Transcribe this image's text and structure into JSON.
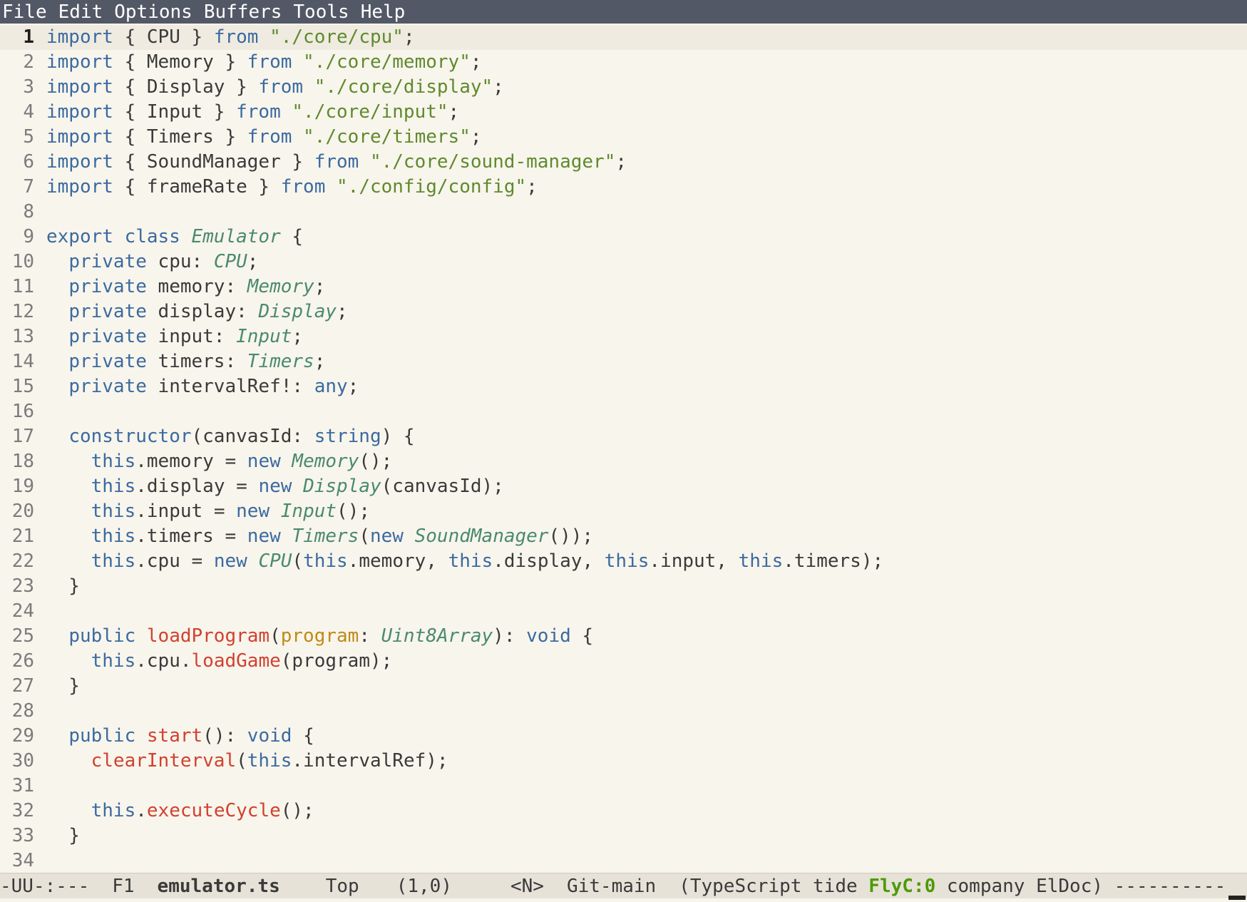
{
  "menubar": {
    "items": [
      "File",
      "Edit",
      "Options",
      "Buffers",
      "Tools",
      "Help"
    ]
  },
  "editor": {
    "current_line": 1,
    "lines": [
      {
        "n": "1",
        "tokens": [
          [
            "keyword",
            "import"
          ],
          [
            "plain",
            " { CPU } "
          ],
          [
            "keyword",
            "from"
          ],
          [
            "plain",
            " "
          ],
          [
            "string",
            "\"./core/cpu\""
          ],
          [
            "plain",
            ";"
          ]
        ]
      },
      {
        "n": "2",
        "tokens": [
          [
            "keyword",
            "import"
          ],
          [
            "plain",
            " { Memory } "
          ],
          [
            "keyword",
            "from"
          ],
          [
            "plain",
            " "
          ],
          [
            "string",
            "\"./core/memory\""
          ],
          [
            "plain",
            ";"
          ]
        ]
      },
      {
        "n": "3",
        "tokens": [
          [
            "keyword",
            "import"
          ],
          [
            "plain",
            " { Display } "
          ],
          [
            "keyword",
            "from"
          ],
          [
            "plain",
            " "
          ],
          [
            "string",
            "\"./core/display\""
          ],
          [
            "plain",
            ";"
          ]
        ]
      },
      {
        "n": "4",
        "tokens": [
          [
            "keyword",
            "import"
          ],
          [
            "plain",
            " { Input } "
          ],
          [
            "keyword",
            "from"
          ],
          [
            "plain",
            " "
          ],
          [
            "string",
            "\"./core/input\""
          ],
          [
            "plain",
            ";"
          ]
        ]
      },
      {
        "n": "5",
        "tokens": [
          [
            "keyword",
            "import"
          ],
          [
            "plain",
            " { Timers } "
          ],
          [
            "keyword",
            "from"
          ],
          [
            "plain",
            " "
          ],
          [
            "string",
            "\"./core/timers\""
          ],
          [
            "plain",
            ";"
          ]
        ]
      },
      {
        "n": "6",
        "tokens": [
          [
            "keyword",
            "import"
          ],
          [
            "plain",
            " { SoundManager } "
          ],
          [
            "keyword",
            "from"
          ],
          [
            "plain",
            " "
          ],
          [
            "string",
            "\"./core/sound-manager\""
          ],
          [
            "plain",
            ";"
          ]
        ]
      },
      {
        "n": "7",
        "tokens": [
          [
            "keyword",
            "import"
          ],
          [
            "plain",
            " { frameRate } "
          ],
          [
            "keyword",
            "from"
          ],
          [
            "plain",
            " "
          ],
          [
            "string",
            "\"./config/config\""
          ],
          [
            "plain",
            ";"
          ]
        ]
      },
      {
        "n": "8",
        "tokens": []
      },
      {
        "n": "9",
        "tokens": [
          [
            "keyword",
            "export class"
          ],
          [
            "plain",
            " "
          ],
          [
            "type",
            "Emulator"
          ],
          [
            "plain",
            " {"
          ]
        ]
      },
      {
        "n": "10",
        "tokens": [
          [
            "plain",
            "  "
          ],
          [
            "keyword",
            "private"
          ],
          [
            "plain",
            " cpu: "
          ],
          [
            "type",
            "CPU"
          ],
          [
            "plain",
            ";"
          ]
        ]
      },
      {
        "n": "11",
        "tokens": [
          [
            "plain",
            "  "
          ],
          [
            "keyword",
            "private"
          ],
          [
            "plain",
            " memory: "
          ],
          [
            "type",
            "Memory"
          ],
          [
            "plain",
            ";"
          ]
        ]
      },
      {
        "n": "12",
        "tokens": [
          [
            "plain",
            "  "
          ],
          [
            "keyword",
            "private"
          ],
          [
            "plain",
            " display: "
          ],
          [
            "type",
            "Display"
          ],
          [
            "plain",
            ";"
          ]
        ]
      },
      {
        "n": "13",
        "tokens": [
          [
            "plain",
            "  "
          ],
          [
            "keyword",
            "private"
          ],
          [
            "plain",
            " input: "
          ],
          [
            "type",
            "Input"
          ],
          [
            "plain",
            ";"
          ]
        ]
      },
      {
        "n": "14",
        "tokens": [
          [
            "plain",
            "  "
          ],
          [
            "keyword",
            "private"
          ],
          [
            "plain",
            " timers: "
          ],
          [
            "type",
            "Timers"
          ],
          [
            "plain",
            ";"
          ]
        ]
      },
      {
        "n": "15",
        "tokens": [
          [
            "plain",
            "  "
          ],
          [
            "keyword",
            "private"
          ],
          [
            "plain",
            " intervalRef!: "
          ],
          [
            "keyword",
            "any"
          ],
          [
            "plain",
            ";"
          ]
        ]
      },
      {
        "n": "16",
        "tokens": []
      },
      {
        "n": "17",
        "tokens": [
          [
            "plain",
            "  "
          ],
          [
            "keyword",
            "constructor"
          ],
          [
            "plain",
            "(canvasId: "
          ],
          [
            "keyword",
            "string"
          ],
          [
            "plain",
            ") {"
          ]
        ]
      },
      {
        "n": "18",
        "tokens": [
          [
            "plain",
            "    "
          ],
          [
            "keyword",
            "this"
          ],
          [
            "plain",
            ".memory = "
          ],
          [
            "keyword",
            "new"
          ],
          [
            "plain",
            " "
          ],
          [
            "type",
            "Memory"
          ],
          [
            "plain",
            "();"
          ]
        ]
      },
      {
        "n": "19",
        "tokens": [
          [
            "plain",
            "    "
          ],
          [
            "keyword",
            "this"
          ],
          [
            "plain",
            ".display = "
          ],
          [
            "keyword",
            "new"
          ],
          [
            "plain",
            " "
          ],
          [
            "type",
            "Display"
          ],
          [
            "plain",
            "(canvasId);"
          ]
        ]
      },
      {
        "n": "20",
        "tokens": [
          [
            "plain",
            "    "
          ],
          [
            "keyword",
            "this"
          ],
          [
            "plain",
            ".input = "
          ],
          [
            "keyword",
            "new"
          ],
          [
            "plain",
            " "
          ],
          [
            "type",
            "Input"
          ],
          [
            "plain",
            "();"
          ]
        ]
      },
      {
        "n": "21",
        "tokens": [
          [
            "plain",
            "    "
          ],
          [
            "keyword",
            "this"
          ],
          [
            "plain",
            ".timers = "
          ],
          [
            "keyword",
            "new"
          ],
          [
            "plain",
            " "
          ],
          [
            "type",
            "Timers"
          ],
          [
            "plain",
            "("
          ],
          [
            "keyword",
            "new"
          ],
          [
            "plain",
            " "
          ],
          [
            "type",
            "SoundManager"
          ],
          [
            "plain",
            "());"
          ]
        ]
      },
      {
        "n": "22",
        "tokens": [
          [
            "plain",
            "    "
          ],
          [
            "keyword",
            "this"
          ],
          [
            "plain",
            ".cpu = "
          ],
          [
            "keyword",
            "new"
          ],
          [
            "plain",
            " "
          ],
          [
            "type",
            "CPU"
          ],
          [
            "plain",
            "("
          ],
          [
            "keyword",
            "this"
          ],
          [
            "plain",
            ".memory, "
          ],
          [
            "keyword",
            "this"
          ],
          [
            "plain",
            ".display, "
          ],
          [
            "keyword",
            "this"
          ],
          [
            "plain",
            ".input, "
          ],
          [
            "keyword",
            "this"
          ],
          [
            "plain",
            ".timers);"
          ]
        ]
      },
      {
        "n": "23",
        "tokens": [
          [
            "plain",
            "  }"
          ]
        ]
      },
      {
        "n": "24",
        "tokens": []
      },
      {
        "n": "25",
        "tokens": [
          [
            "plain",
            "  "
          ],
          [
            "keyword",
            "public"
          ],
          [
            "plain",
            " "
          ],
          [
            "func",
            "loadProgram"
          ],
          [
            "plain",
            "("
          ],
          [
            "param",
            "program"
          ],
          [
            "plain",
            ": "
          ],
          [
            "type",
            "Uint8Array"
          ],
          [
            "plain",
            "): "
          ],
          [
            "keyword",
            "void"
          ],
          [
            "plain",
            " {"
          ]
        ]
      },
      {
        "n": "26",
        "tokens": [
          [
            "plain",
            "    "
          ],
          [
            "keyword",
            "this"
          ],
          [
            "plain",
            ".cpu."
          ],
          [
            "func",
            "loadGame"
          ],
          [
            "plain",
            "(program);"
          ]
        ]
      },
      {
        "n": "27",
        "tokens": [
          [
            "plain",
            "  }"
          ]
        ]
      },
      {
        "n": "28",
        "tokens": []
      },
      {
        "n": "29",
        "tokens": [
          [
            "plain",
            "  "
          ],
          [
            "keyword",
            "public"
          ],
          [
            "plain",
            " "
          ],
          [
            "func",
            "start"
          ],
          [
            "plain",
            "(): "
          ],
          [
            "keyword",
            "void"
          ],
          [
            "plain",
            " {"
          ]
        ]
      },
      {
        "n": "30",
        "tokens": [
          [
            "plain",
            "    "
          ],
          [
            "func",
            "clearInterval"
          ],
          [
            "plain",
            "("
          ],
          [
            "keyword",
            "this"
          ],
          [
            "plain",
            ".intervalRef);"
          ]
        ]
      },
      {
        "n": "31",
        "tokens": []
      },
      {
        "n": "32",
        "tokens": [
          [
            "plain",
            "    "
          ],
          [
            "keyword",
            "this"
          ],
          [
            "plain",
            "."
          ],
          [
            "func",
            "executeCycle"
          ],
          [
            "plain",
            "();"
          ]
        ]
      },
      {
        "n": "33",
        "tokens": [
          [
            "plain",
            "  }"
          ]
        ]
      },
      {
        "n": "34",
        "tokens": []
      }
    ]
  },
  "modeline": {
    "status": "-UU-:---",
    "frame": "F1",
    "buffer_name": "emulator.ts",
    "position": "Top",
    "line_col": "(1,0)",
    "evil_state": "<N>",
    "vc": "Git-main",
    "modes_open": "(TypeScript tide ",
    "flycheck": "FlyC:0",
    "modes_close": " company ElDoc)",
    "fill": " ----------"
  },
  "colors": {
    "background": "#f8f5ec",
    "menubar": "#535866",
    "keyword": "#3b6aa0",
    "type": "#4a8a6e",
    "string": "#5f8a2e",
    "function": "#d14130",
    "parameter": "#c08a16",
    "flycheck": "#4e9a06"
  }
}
